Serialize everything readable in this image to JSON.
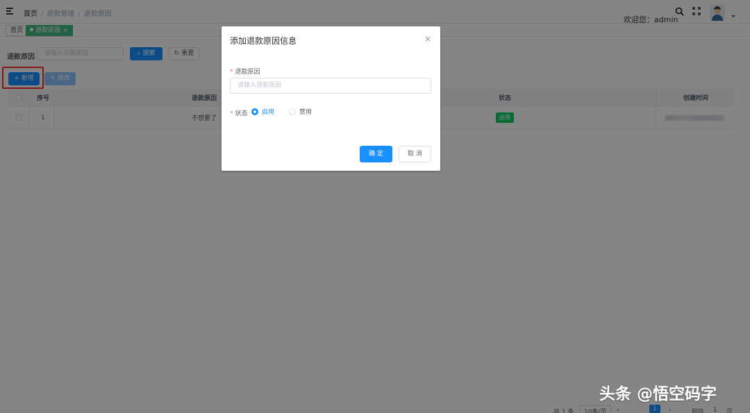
{
  "header": {
    "breadcrumb": [
      "首页",
      "退款管理",
      "退款原因"
    ],
    "welcome": "欢迎您：admin"
  },
  "tags": {
    "home": "首页",
    "active": "退款原因",
    "active_close": "×"
  },
  "filter": {
    "label": "退款原因",
    "placeholder": "请输入退款原因",
    "search_label": "搜索",
    "reset_label": "重置"
  },
  "toolbar": {
    "add_label": "+ 新增",
    "edit_label": "修改"
  },
  "table": {
    "columns": [
      "序号",
      "退款原因",
      "状态",
      "创建时间"
    ],
    "rows": [
      {
        "index": "1",
        "reason": "不想要了",
        "status": "启用",
        "created": ""
      }
    ]
  },
  "pagination": {
    "total": "共 1 条",
    "page_size": "10条/页",
    "current": "1",
    "goto_label": "前往",
    "goto_value": "1",
    "page_unit": "页"
  },
  "dialog": {
    "title": "添加退款原因信息",
    "close": "×",
    "reason_label": "退款原因",
    "reason_placeholder": "请输入退款原因",
    "status_label": "状态",
    "status_options": [
      "启用",
      "禁用"
    ],
    "status_selected": "启用",
    "ok_label": "确 定",
    "cancel_label": "取 消"
  },
  "watermark": "头条 @悟空码字",
  "colors": {
    "primary": "#1890ff",
    "tag_active": "#42b983",
    "status_green": "#13ce66",
    "highlight_red": "#ff2d2d"
  }
}
